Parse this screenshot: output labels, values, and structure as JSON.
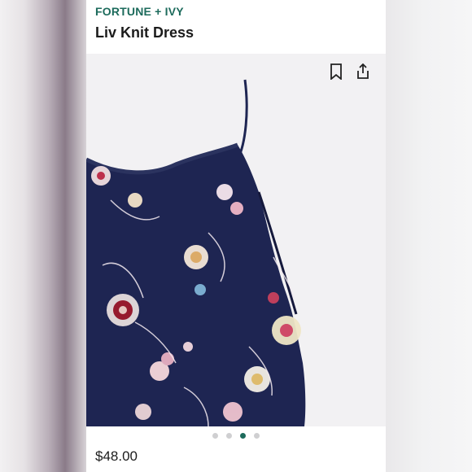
{
  "product": {
    "brand": "FORTUNE + IVY",
    "name": "Liv Knit Dress",
    "price": "$48.00"
  },
  "actions": {
    "save_icon": "bookmark-icon",
    "share_icon": "share-icon"
  },
  "carousel": {
    "total": 4,
    "active_index": 2
  },
  "colors": {
    "brand": "#1d6b5c",
    "dress": "#1e2552",
    "dot_inactive": "#cfcfd1"
  }
}
